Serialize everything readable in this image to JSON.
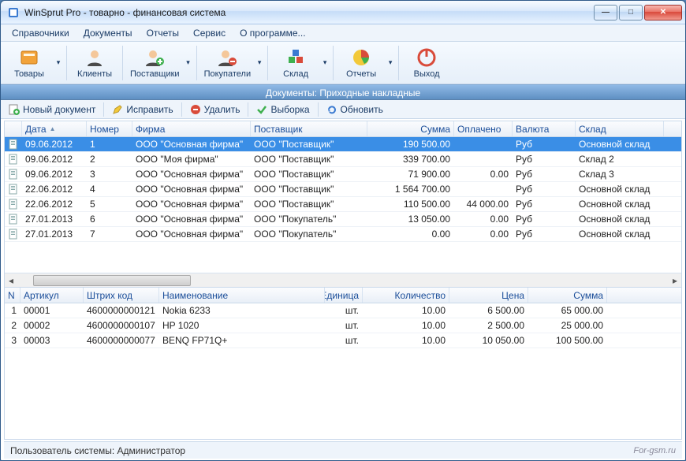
{
  "window": {
    "title": "WinSprut Pro - товарно - финансовая система"
  },
  "menu": [
    "Справочники",
    "Документы",
    "Отчеты",
    "Сервис",
    "О программе..."
  ],
  "toolbar": [
    {
      "id": "goods",
      "label": "Товары",
      "icon": "goods",
      "dropdown": true
    },
    {
      "id": "clients",
      "label": "Клиенты",
      "icon": "person",
      "dropdown": false
    },
    {
      "id": "vendors",
      "label": "Поставщики",
      "icon": "person-plus",
      "dropdown": true
    },
    {
      "id": "buyers",
      "label": "Покупатели",
      "icon": "person-minus",
      "dropdown": true
    },
    {
      "id": "stock",
      "label": "Склад",
      "icon": "boxes",
      "dropdown": true
    },
    {
      "id": "reports",
      "label": "Отчеты",
      "icon": "pie",
      "dropdown": true
    },
    {
      "id": "exit",
      "label": "Выход",
      "icon": "power",
      "dropdown": false
    }
  ],
  "section_title": "Документы: Приходные накладные",
  "docbar": {
    "new": "Новый документ",
    "edit": "Исправить",
    "delete": "Удалить",
    "filter": "Выборка",
    "refresh": "Обновить"
  },
  "docs": {
    "columns": [
      "Дата",
      "Номер",
      "Фирма",
      "Поставщик",
      "Сумма",
      "Оплачено",
      "Валюта",
      "Склад"
    ],
    "rows": [
      {
        "date": "09.06.2012",
        "num": "1",
        "firm": "ООО \"Основная фирма\"",
        "supp": "ООО \"Поставщик\"",
        "sum": "190 500.00",
        "paid": "",
        "cur": "Руб",
        "wh": "Основной склад",
        "sel": true
      },
      {
        "date": "09.06.2012",
        "num": "2",
        "firm": "ООО \"Моя фирма\"",
        "supp": "ООО \"Поставщик\"",
        "sum": "339 700.00",
        "paid": "",
        "cur": "Руб",
        "wh": "Склад 2"
      },
      {
        "date": "09.06.2012",
        "num": "3",
        "firm": "ООО \"Основная фирма\"",
        "supp": "ООО \"Поставщик\"",
        "sum": "71 900.00",
        "paid": "0.00",
        "cur": "Руб",
        "wh": "Склад 3"
      },
      {
        "date": "22.06.2012",
        "num": "4",
        "firm": "ООО \"Основная фирма\"",
        "supp": "ООО \"Поставщик\"",
        "sum": "1 564 700.00",
        "paid": "",
        "cur": "Руб",
        "wh": "Основной склад"
      },
      {
        "date": "22.06.2012",
        "num": "5",
        "firm": "ООО \"Основная фирма\"",
        "supp": "ООО \"Поставщик\"",
        "sum": "110 500.00",
        "paid": "44 000.00",
        "cur": "Руб",
        "wh": "Основной склад"
      },
      {
        "date": "27.01.2013",
        "num": "6",
        "firm": "ООО \"Основная фирма\"",
        "supp": "ООО \"Покупатель\"",
        "sum": "13 050.00",
        "paid": "0.00",
        "cur": "Руб",
        "wh": "Основной склад"
      },
      {
        "date": "27.01.2013",
        "num": "7",
        "firm": "ООО \"Основная фирма\"",
        "supp": "ООО \"Покупатель\"",
        "sum": "0.00",
        "paid": "0.00",
        "cur": "Руб",
        "wh": "Основной склад"
      }
    ]
  },
  "items": {
    "columns": [
      "N",
      "Артикул",
      "Штрих код",
      "Наименование",
      "Единица",
      "Количество",
      "Цена",
      "Сумма"
    ],
    "rows": [
      {
        "n": "1",
        "art": "00001",
        "bar": "4600000000121",
        "name": "Nokia 6233",
        "unit": "шт.",
        "qty": "10.00",
        "price": "6 500.00",
        "total": "65 000.00"
      },
      {
        "n": "2",
        "art": "00002",
        "bar": "4600000000107",
        "name": "HP 1020",
        "unit": "шт.",
        "qty": "10.00",
        "price": "2 500.00",
        "total": "25 000.00"
      },
      {
        "n": "3",
        "art": "00003",
        "bar": "4600000000077",
        "name": "BENQ FP71Q+",
        "unit": "шт.",
        "qty": "10.00",
        "price": "10 050.00",
        "total": "100 500.00"
      }
    ]
  },
  "status": "Пользователь системы: Администратор",
  "footer_site": "For-gsm.ru"
}
